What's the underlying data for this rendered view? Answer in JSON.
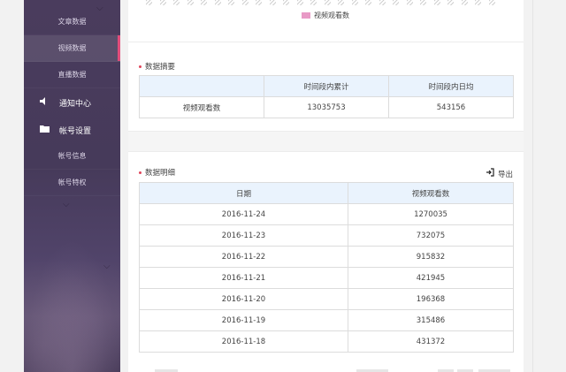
{
  "sidebar": {
    "items": [
      {
        "label": "文章数据"
      },
      {
        "label": "视频数据"
      },
      {
        "label": "直播数据"
      }
    ],
    "notification": {
      "label": "通知中心"
    },
    "account": {
      "label": "帐号设置"
    },
    "account_items": [
      {
        "label": "帐号信息"
      },
      {
        "label": "帐号特权"
      }
    ]
  },
  "chart": {
    "legend_label": "视频观看数",
    "legend_color": "#e89ac6"
  },
  "summary": {
    "title": "数据摘要",
    "headers": [
      "",
      "时间段内累计",
      "时间段内日均"
    ],
    "row": {
      "label": "视频观看数",
      "total": "13035753",
      "daily_avg": "543156"
    }
  },
  "detail": {
    "title": "数据明细",
    "export_label": "导出",
    "headers": [
      "日期",
      "视频观看数"
    ],
    "rows": [
      {
        "date": "2016-11-24",
        "views": "1270035"
      },
      {
        "date": "2016-11-23",
        "views": "732075"
      },
      {
        "date": "2016-11-22",
        "views": "915832"
      },
      {
        "date": "2016-11-21",
        "views": "421945"
      },
      {
        "date": "2016-11-20",
        "views": "196368"
      },
      {
        "date": "2016-11-19",
        "views": "315486"
      },
      {
        "date": "2016-11-18",
        "views": "431372"
      }
    ]
  },
  "colors": {
    "sidebar_bg": "#4a3c5d",
    "active_marker": "#e24d7b",
    "table_header_bg": "#eaf3fd",
    "section_dot": "#e0445a"
  }
}
